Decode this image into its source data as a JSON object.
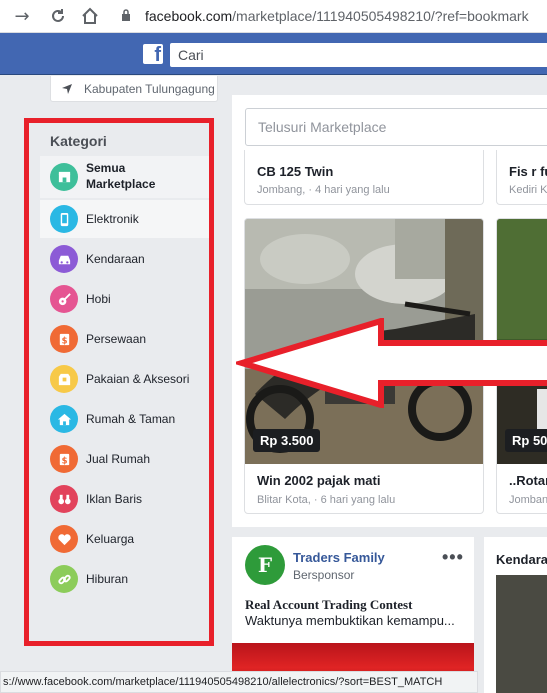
{
  "browser": {
    "url_host": "facebook.com",
    "url_path": "/marketplace/111940505498210/?ref=bookmark",
    "status_url": "s://www.facebook.com/marketplace/111940505498210/allelectronics/?sort=BEST_MATCH"
  },
  "header": {
    "logo": "f",
    "search_placeholder": "Cari"
  },
  "location": "Kabupaten Tulungagung",
  "sidebar": {
    "title": "Kategori",
    "items": [
      {
        "label": "Semua Marketplace",
        "icon": "store-icon",
        "color": "#3ebf9a"
      },
      {
        "label": "Elektronik",
        "icon": "phone-icon",
        "color": "#2ab8e4"
      },
      {
        "label": "Kendaraan",
        "icon": "car-icon",
        "color": "#8c5bd6"
      },
      {
        "label": "Hobi",
        "icon": "guitar-icon",
        "color": "#e55592"
      },
      {
        "label": "Persewaan",
        "icon": "dollar-tag-icon",
        "color": "#f06a35"
      },
      {
        "label": "Pakaian & Aksesori",
        "icon": "shirt-icon",
        "color": "#f7c948"
      },
      {
        "label": "Rumah & Taman",
        "icon": "house-icon",
        "color": "#2ab8e4"
      },
      {
        "label": "Jual Rumah",
        "icon": "dollar-tag-icon",
        "color": "#f06a35"
      },
      {
        "label": "Iklan Baris",
        "icon": "binoculars-icon",
        "color": "#e2435c"
      },
      {
        "label": "Keluarga",
        "icon": "heart-icon",
        "color": "#f06a35"
      },
      {
        "label": "Hiburan",
        "icon": "link-icon",
        "color": "#8ccc5a"
      }
    ]
  },
  "main": {
    "search_placeholder": "Telusuri Marketplace",
    "listings": [
      {
        "title": "CB 125 Twin",
        "meta": "Jombang, · 4 hari yang lalu"
      },
      {
        "title": "Fis r fu",
        "meta": "Kediri Ko"
      },
      {
        "title": "Win 2002 pajak mati",
        "meta": "Blitar Kota, · 6 hari yang lalu",
        "price": "Rp 3.500"
      },
      {
        "title": "..Rotan",
        "meta": "Jombang",
        "price": "Rp 50"
      }
    ],
    "sponsored": {
      "avatar_letter": "F",
      "name": "Traders Family",
      "label": "Bersponsor",
      "headline": "Real Account Trading Contest",
      "body": "Waktunya membuktikan kemampu...",
      "menu": "•••"
    },
    "side_section": "Kendara"
  }
}
